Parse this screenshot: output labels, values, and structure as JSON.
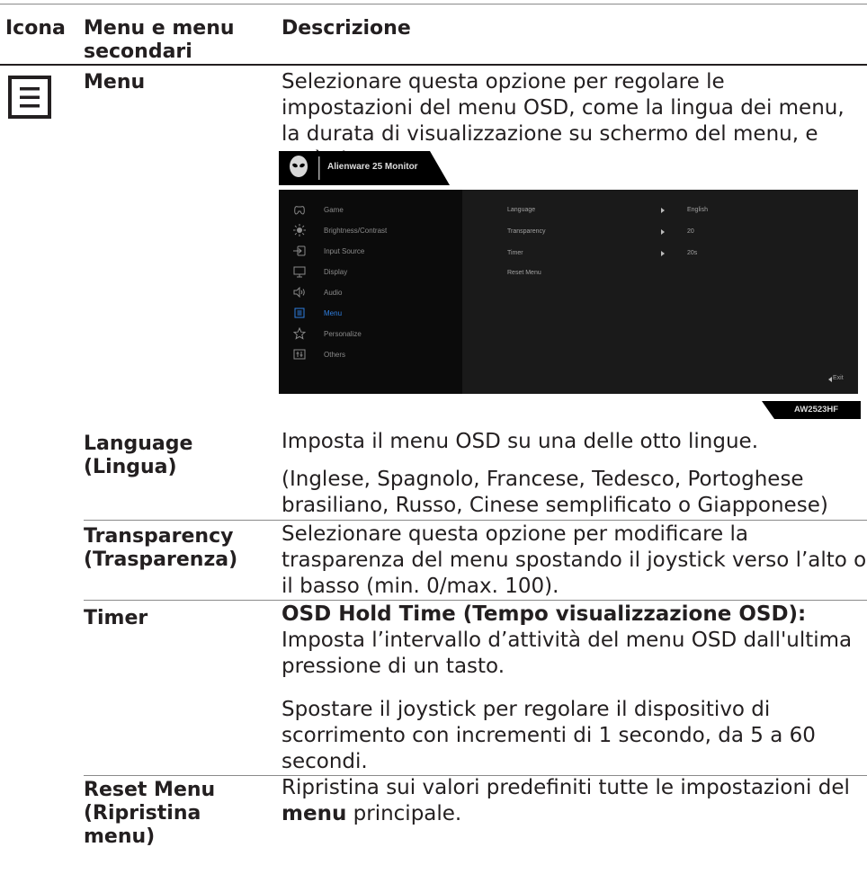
{
  "header": {
    "col_icon": "Icona",
    "col_menu_1": "Menu e menu",
    "col_menu_2": "secondari",
    "col_desc": "Descrizione"
  },
  "rows": {
    "menu": {
      "term": "Menu",
      "desc": "Selezionare questa opzione per regolare le impostazioni del menu OSD, come la lingua dei menu, la durata di visualizzazione su schermo del menu, e così via."
    },
    "language": {
      "term_1": "Language",
      "term_2": "(Lingua)",
      "desc_1": "Imposta il menu OSD su una delle otto lingue.",
      "desc_2": "(Inglese, Spagnolo, Francese, Tedesco, Portoghese brasiliano, Russo, Cinese semplificato o Giapponese)"
    },
    "transparency": {
      "term_1": "Transparency",
      "term_2": "(Trasparenza)",
      "desc": "Selezionare questa opzione per modificare la trasparenza del menu spostando il joystick verso l’alto o il basso (min. 0/max. 100)."
    },
    "timer": {
      "term": "Timer",
      "desc_bold": "OSD Hold Time (Tempo visualizzazione OSD):",
      "desc_rest": " Imposta l’intervallo d’attività del menu OSD dall'ultima pressione di un tasto.",
      "desc_2": "Spostare il joystick per regolare il dispositivo di scorrimento con incrementi di 1 secondo, da 5 a 60 secondi."
    },
    "reset": {
      "term_1": "Reset Menu",
      "term_2": "(Ripristina",
      "term_3": "menu)",
      "desc_pre": "Ripristina sui valori predefiniti tutte le impostazioni del ",
      "desc_bold": "menu",
      "desc_post": " principale."
    }
  },
  "osd": {
    "title": "Alienware 25 Monitor",
    "model": "AW2523HF",
    "exit": "Exit",
    "menu_items": [
      "Game",
      "Brightness/Contrast",
      "Input Source",
      "Display",
      "Audio",
      "Menu",
      "Personalize",
      "Others"
    ],
    "active_index": 5,
    "options": [
      {
        "label": "Language",
        "value": "English"
      },
      {
        "label": "Transparency",
        "value": "20"
      },
      {
        "label": "Timer",
        "value": "20s"
      },
      {
        "label": "Reset Menu",
        "value": ""
      }
    ],
    "colors": {
      "active": "#2f7fe0",
      "panel_left": "#0b0b0b",
      "panel_right": "#1a1a1a"
    }
  }
}
